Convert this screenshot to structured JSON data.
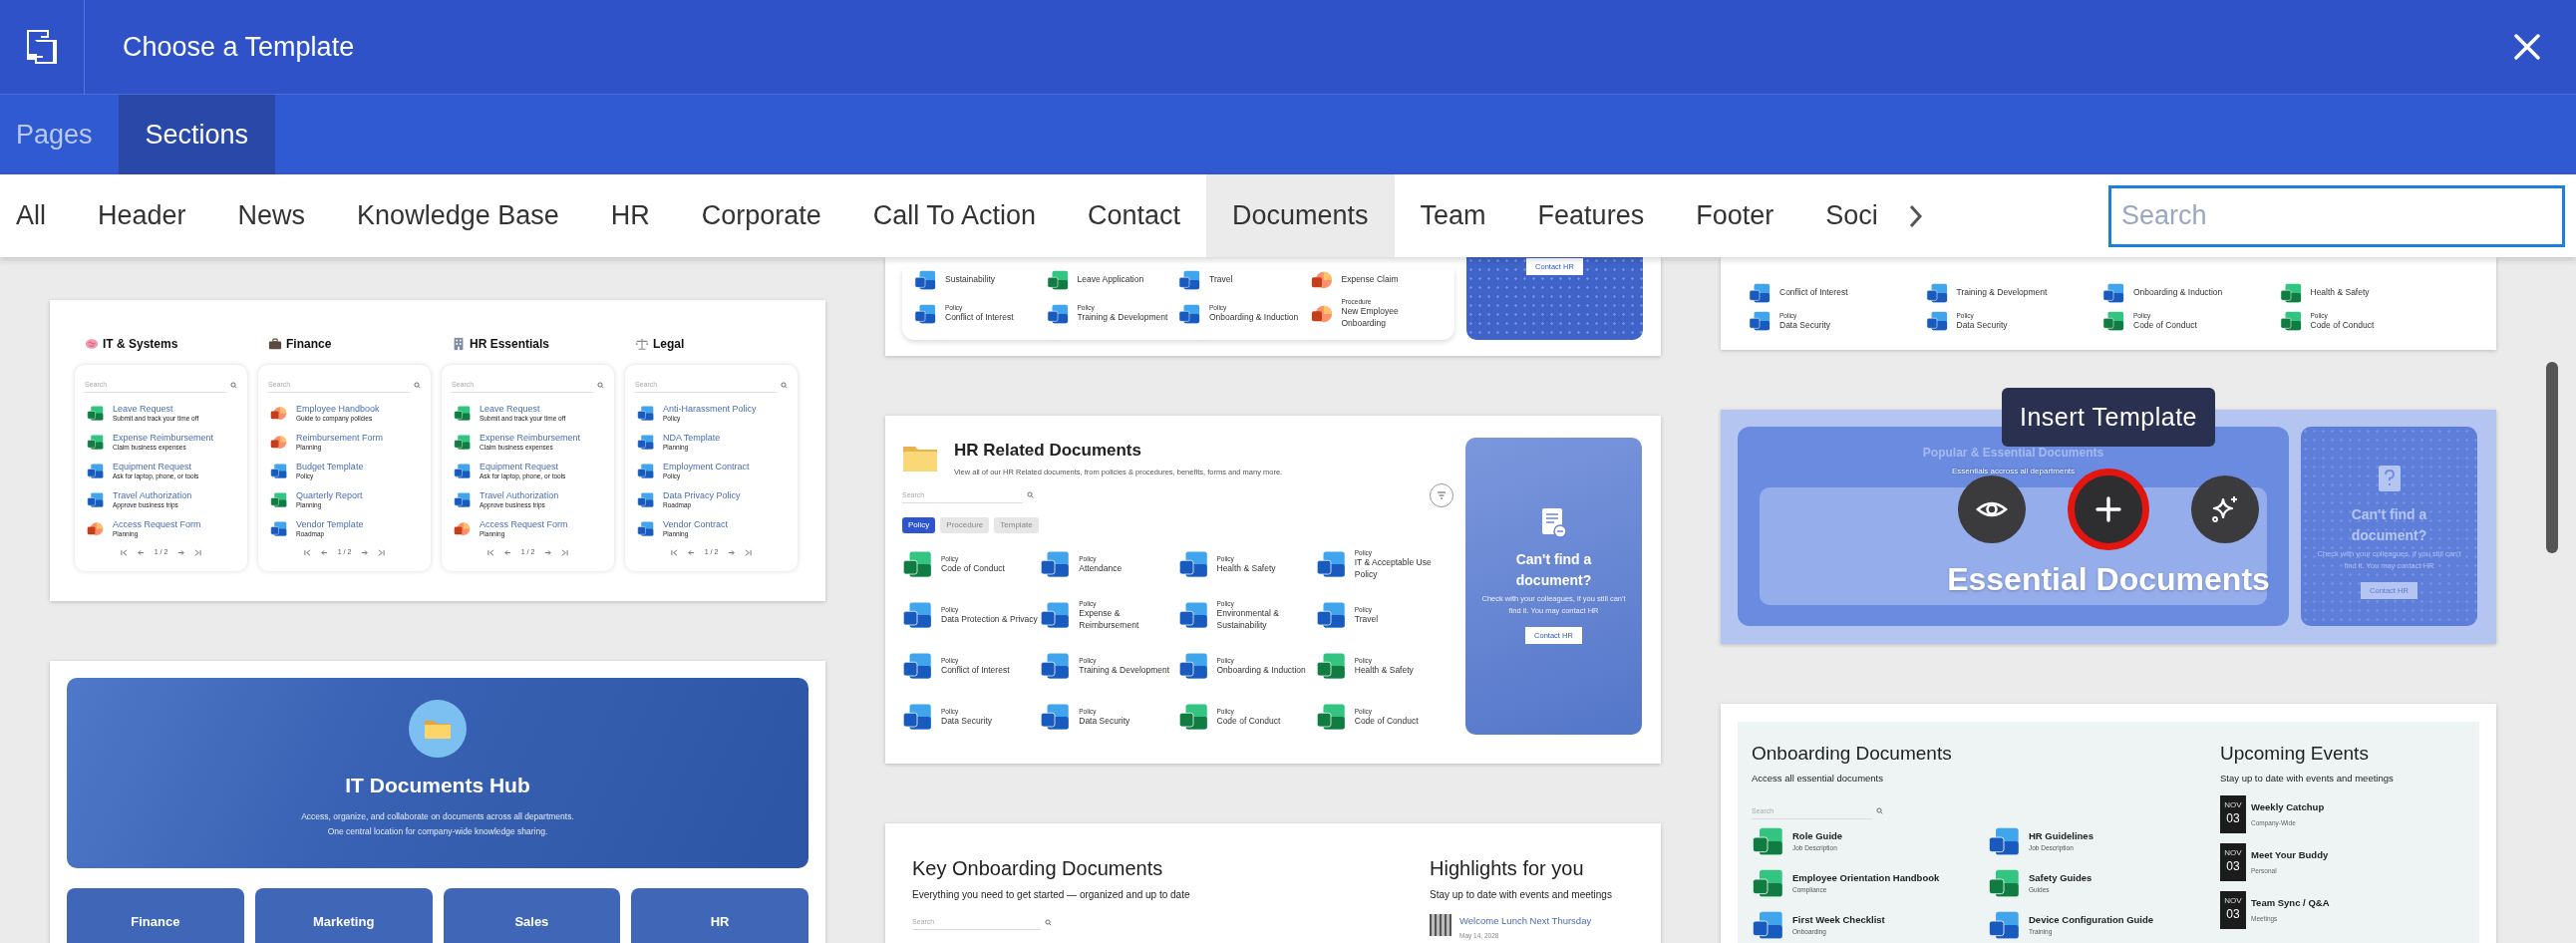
{
  "header": {
    "title": "Choose a Template"
  },
  "mode_tabs": [
    {
      "label": "Pages",
      "selected": false
    },
    {
      "label": "Sections",
      "selected": true
    }
  ],
  "categories": [
    {
      "label": "All",
      "selected": false
    },
    {
      "label": "Header",
      "selected": false
    },
    {
      "label": "News",
      "selected": false
    },
    {
      "label": "Knowledge Base",
      "selected": false
    },
    {
      "label": "HR",
      "selected": false
    },
    {
      "label": "Corporate",
      "selected": false
    },
    {
      "label": "Call To Action",
      "selected": false
    },
    {
      "label": "Contact",
      "selected": false
    },
    {
      "label": "Documents",
      "selected": true
    },
    {
      "label": "Team",
      "selected": false
    },
    {
      "label": "Features",
      "selected": false
    },
    {
      "label": "Footer",
      "selected": false
    },
    {
      "label": "Soci",
      "selected": false
    }
  ],
  "search": {
    "placeholder": "Search"
  },
  "columns": [
    [
      {
        "kind": "category_lists",
        "groups": [
          {
            "title": "IT & Systems",
            "search_placeholder": "Search",
            "pager": "1 / 2",
            "items": [
              {
                "name": "Leave Request",
                "sub": "Submit and track your time off",
                "kind": "excel"
              },
              {
                "name": "Expense Reimbursement",
                "sub": "Claim business expenses",
                "kind": "excel"
              },
              {
                "name": "Equipment Request",
                "sub": "Ask for laptop, phone, or tools",
                "kind": "word"
              },
              {
                "name": "Travel Authorization",
                "sub": "Approve business trips",
                "kind": "word"
              },
              {
                "name": "Access Request Form",
                "sub": "Planning",
                "kind": "powerpoint"
              }
            ]
          },
          {
            "title": "Finance",
            "search_placeholder": "Search",
            "pager": "1 / 2",
            "items": [
              {
                "name": "Employee Handbook",
                "sub": "Guide to company policies",
                "kind": "powerpoint"
              },
              {
                "name": "Reimbursement Form",
                "sub": "Planning",
                "kind": "powerpoint"
              },
              {
                "name": "Budget Template",
                "sub": "Policy",
                "kind": "word"
              },
              {
                "name": "Quarterly Report",
                "sub": "Planning",
                "kind": "excel"
              },
              {
                "name": "Vendor Template",
                "sub": "Roadmap",
                "kind": "word"
              }
            ]
          },
          {
            "title": "HR Essentials",
            "search_placeholder": "Search",
            "pager": "1 / 2",
            "items": [
              {
                "name": "Leave Request",
                "sub": "Submit and track your time off",
                "kind": "excel"
              },
              {
                "name": "Expense Reimbursement",
                "sub": "Claim business expenses",
                "kind": "excel"
              },
              {
                "name": "Equipment Request",
                "sub": "Ask for laptop, phone, or tools",
                "kind": "word"
              },
              {
                "name": "Travel Authorization",
                "sub": "Approve business trips",
                "kind": "word"
              },
              {
                "name": "Access Request Form",
                "sub": "Planning",
                "kind": "powerpoint"
              }
            ]
          },
          {
            "title": "Legal",
            "search_placeholder": "Search",
            "pager": "1 / 2",
            "items": [
              {
                "name": "Anti-Harassment Policy",
                "sub": "Policy",
                "kind": "word"
              },
              {
                "name": "NDA Template",
                "sub": "Planning",
                "kind": "word"
              },
              {
                "name": "Employment Contract",
                "sub": "Policy",
                "kind": "word"
              },
              {
                "name": "Data Privacy Policy",
                "sub": "Roadmap",
                "kind": "word"
              },
              {
                "name": "Vendor Contract",
                "sub": "Planning",
                "kind": "word"
              }
            ]
          }
        ]
      },
      {
        "kind": "hub",
        "title": "IT Documents Hub",
        "lines": [
          "Access, organize, and collaborate on documents across all departments.",
          "One central location for company-wide knowledge sharing."
        ],
        "departments": [
          "Finance",
          "Marketing",
          "Sales",
          "HR"
        ]
      }
    ],
    [
      {
        "kind": "doc_grid_panel",
        "items": [
          {
            "name": "Sustainability",
            "kind": "word"
          },
          {
            "name": "Leave Application",
            "kind": "excel"
          },
          {
            "name": "Travel",
            "kind": "word"
          },
          {
            "name": "Expense Claim",
            "kind": "powerpoint"
          },
          {
            "type": "Policy",
            "name": "Conflict of Interest",
            "kind": "word"
          },
          {
            "type": "Policy",
            "name": "Training & Development",
            "kind": "word"
          },
          {
            "type": "Policy",
            "name": "Onboarding & Induction",
            "kind": "word"
          },
          {
            "type": "Procedure",
            "name": "New Employee Onboarding",
            "kind": "powerpoint"
          }
        ],
        "button": "Contact HR"
      },
      {
        "kind": "hr_docs",
        "title": "HR Related Documents",
        "subtitle": "View all of our HR Related documents, from policies & procedures, benefits, forms and many more.",
        "search_placeholder": "Search",
        "filters": [
          {
            "label": "Policy",
            "selected": true
          },
          {
            "label": "Procedure",
            "selected": false
          },
          {
            "label": "Template",
            "selected": false
          }
        ],
        "items": [
          {
            "type": "Policy",
            "name": "Code of Conduct",
            "kind": "excel"
          },
          {
            "type": "Policy",
            "name": "Attendance",
            "kind": "word"
          },
          {
            "type": "Policy",
            "name": "Health & Safety",
            "kind": "word"
          },
          {
            "type": "Policy",
            "name": "IT & Acceptable Use Policy",
            "kind": "word"
          },
          {
            "type": "Policy",
            "name": "Data Protection & Privacy",
            "kind": "word"
          },
          {
            "type": "Policy",
            "name": "Expense & Reimbursement",
            "kind": "word"
          },
          {
            "type": "Policy",
            "name": "Environmental & Sustainability",
            "kind": "word"
          },
          {
            "type": "Policy",
            "name": "Travel",
            "kind": "word"
          },
          {
            "type": "Policy",
            "name": "Conflict of Interest",
            "kind": "word"
          },
          {
            "type": "Policy",
            "name": "Training & Development",
            "kind": "word"
          },
          {
            "type": "Policy",
            "name": "Onboarding & Induction",
            "kind": "word"
          },
          {
            "type": "Policy",
            "name": "Health & Safety",
            "kind": "excel"
          },
          {
            "type": "Policy",
            "name": "Data Security",
            "kind": "word"
          },
          {
            "type": "Policy",
            "name": "Data Security",
            "kind": "word"
          },
          {
            "type": "Policy",
            "name": "Code of Conduct",
            "kind": "excel"
          },
          {
            "type": "Policy",
            "name": "Code of Conduct",
            "kind": "excel"
          }
        ],
        "panel": {
          "title": "Can't find a document?",
          "text": "Check with your colleagues, if you still can't find it. You may contact HR",
          "button": "Contact HR"
        }
      },
      {
        "kind": "key_onboarding",
        "title": "Key Onboarding Documents",
        "subtitle": "Everything you need to get started — organized and up to date",
        "search_placeholder": "Search",
        "highlights_title": "Highlights for you",
        "highlights_subtitle": "Stay up to date with events and meetings",
        "events": [
          {
            "title": "Welcome Lunch Next Thursday",
            "date": "May 14, 2028"
          }
        ]
      }
    ],
    [
      {
        "kind": "doc_grid",
        "items": [
          {
            "name": "Conflict of Interest",
            "kind": "word"
          },
          {
            "name": "Training & Development",
            "kind": "word"
          },
          {
            "name": "Onboarding & Induction",
            "kind": "word"
          },
          {
            "name": "Health & Safety",
            "kind": "excel"
          },
          {
            "type": "Policy",
            "name": "Data Security",
            "kind": "word"
          },
          {
            "type": "Policy",
            "name": "Data Security",
            "kind": "word"
          },
          {
            "type": "Policy",
            "name": "Code of Conduct",
            "kind": "excel"
          },
          {
            "type": "Policy",
            "name": "Code of Conduct",
            "kind": "excel"
          }
        ]
      },
      {
        "kind": "essential",
        "hovered": true,
        "heading": "Popular & Essential Documents",
        "subheading": "Essentials accross all departments",
        "panel": {
          "title": "Can't find a document?",
          "text": "Check with your colleagues, if you still can't find it. You may contact HR",
          "button": "Contact HR"
        },
        "overlay": {
          "title": "Essential Documents",
          "tooltip": "Insert Template",
          "actions": [
            {
              "kind": "preview",
              "highlighted": false
            },
            {
              "kind": "insert",
              "highlighted": true
            },
            {
              "kind": "ai",
              "highlighted": false
            }
          ]
        }
      },
      {
        "kind": "onboarding_events",
        "title": "Onboarding Documents",
        "subtitle": "Access all essential documents",
        "search_placeholder": "Search",
        "docs": [
          {
            "name": "Role Guide",
            "sub": "Job Description",
            "kind": "excel"
          },
          {
            "name": "HR Guidelines",
            "sub": "Job Description",
            "kind": "word"
          },
          {
            "name": "Employee Orientation Handbook",
            "sub": "Compliance",
            "kind": "excel"
          },
          {
            "name": "Safety Guides",
            "sub": "Guides",
            "kind": "excel"
          },
          {
            "name": "First Week Checklist",
            "sub": "Onboarding",
            "kind": "word"
          },
          {
            "name": "Device Configuration Guide",
            "sub": "Training",
            "kind": "word"
          }
        ],
        "events_title": "Upcoming Events",
        "events_subtitle": "Stay up to date with events and meetings",
        "events": [
          {
            "month": "NOV",
            "day": "03",
            "title": "Weekly Catchup",
            "sub": "Company-Wide"
          },
          {
            "month": "NOV",
            "day": "03",
            "title": "Meet Your Buddy",
            "sub": "Personal"
          },
          {
            "month": "NOV",
            "day": "03",
            "title": "Team Sync / Q&A",
            "sub": "Meetings"
          }
        ]
      }
    ]
  ]
}
